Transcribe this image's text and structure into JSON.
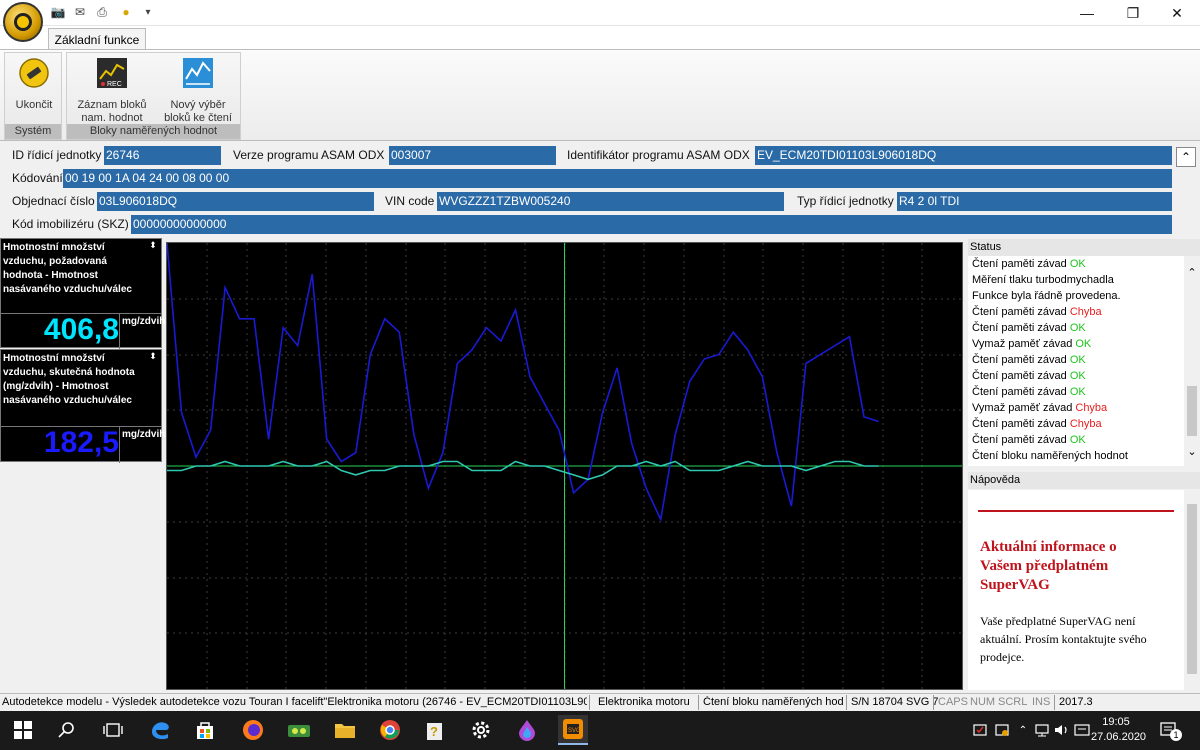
{
  "ribbon": {
    "tab_label": "Základní funkce",
    "groups": [
      {
        "label": "Systém",
        "buttons": [
          {
            "label": "Ukončit"
          }
        ]
      },
      {
        "label": "Bloky naměřených hodnot",
        "buttons": [
          {
            "label": "Záznam bloků nam. hodnot"
          },
          {
            "label": "Nový výběr bloků ke čtení"
          }
        ]
      }
    ]
  },
  "info": {
    "ecu_id_label": "ID řídicí jednotky",
    "ecu_id_value": "26746",
    "asam_ver_label": "Verze programu ASAM ODX",
    "asam_ver_value": "003007",
    "asam_id_label": "Identifikátor programu ASAM ODX",
    "asam_id_value": "EV_ECM20TDI01103L906018DQ",
    "coding_label": "Kódování",
    "coding_value": "00 19 00 1A 04 24 00 08 00 00",
    "order_label": "Objednací číslo",
    "order_value": "03L906018DQ",
    "vin_label": "VIN code",
    "vin_value": "WVGZZZ1TZBW005240",
    "ecu_type_label": "Typ řídicí jednotky",
    "ecu_type_value": "R4 2 0l TDI",
    "immo_label": "Kód imobilizéru (SKZ)",
    "immo_value": "00000000000000"
  },
  "sensors": [
    {
      "title": "Hmotnostní množství vzduchu, požadovaná hodnota - Hmotnost nasávaného vzduchu/válec",
      "value": "406,8",
      "unit": "mg/zdvih",
      "color": "#00e5ff"
    },
    {
      "title": "Hmotnostní množství vzduchu, skutečná hodnota (mg/zdvih) - Hmotnost nasávaného vzduchu/válec",
      "value": "182,5",
      "unit": "mg/zdvih",
      "color": "#1a1aff"
    }
  ],
  "status": {
    "header": "Status",
    "lines": [
      {
        "text": "Čtení paměti závad ",
        "result": "OK"
      },
      {
        "text": "Měření tlaku turbodmychadla",
        "result": ""
      },
      {
        "text": "Funkce byla řádně provedena.",
        "result": ""
      },
      {
        "text": "Čtení paměti závad ",
        "result": "Chyba"
      },
      {
        "text": "Čtení paměti závad ",
        "result": "OK"
      },
      {
        "text": "Vymaž paměť závad ",
        "result": "OK"
      },
      {
        "text": "Čtení paměti závad ",
        "result": "OK"
      },
      {
        "text": "Čtení paměti závad ",
        "result": "OK"
      },
      {
        "text": "Čtení paměti závad ",
        "result": "OK"
      },
      {
        "text": "Vymaž paměť závad ",
        "result": "Chyba"
      },
      {
        "text": "Čtení paměti závad ",
        "result": "Chyba"
      },
      {
        "text": "Čtení paměti závad ",
        "result": "OK"
      },
      {
        "text": "Čtení bloku naměřených hodnot",
        "result": ""
      }
    ]
  },
  "help": {
    "header": "Nápověda",
    "title": "Aktuální informace o Vašem předplatném SuperVAG",
    "body": "Vaše předplatné SuperVAG není aktuální. Prosím kontaktujte svého prodejce."
  },
  "statusbar": {
    "model": "Autodetekce modelu - Výsledek autodetekce vozu Touran I facelift\"Elektronika motoru (26746 - EV_ECM20TDI01103L906018DQ_",
    "module": "Elektronika motoru",
    "operation": "Čtení bloku naměřených hodno",
    "serial": "S/N 18704 SVG 7",
    "caps": "CAPS",
    "num": "NUM",
    "scrl": "SCRL",
    "ins": "INS",
    "version": "2017.3"
  },
  "taskbar": {
    "time": "19:05",
    "date": "27.06.2020",
    "notif_count": "1"
  },
  "chart_data": {
    "type": "line",
    "series": [
      {
        "values": [
          1.0,
          0.62,
          0.52,
          0.58,
          0.9,
          0.83,
          0.83,
          0.56,
          0.81,
          0.77,
          0.93,
          0.56,
          0.51,
          0.53,
          0.75,
          0.83,
          0.8,
          0.57,
          0.45,
          0.53,
          0.73,
          0.76,
          0.81,
          0.78,
          0.85,
          0.7,
          0.64,
          0.58,
          0.44,
          0.47,
          0.62,
          0.72,
          0.55,
          0.45,
          0.38,
          0.57,
          0.69,
          0.74,
          0.75,
          0.8,
          0.76,
          0.7,
          0.53,
          0.41,
          0.73,
          0.75,
          0.77,
          0.79,
          0.61,
          0.6
        ]
      },
      {
        "values": [
          0.49,
          0.49,
          0.5,
          0.5,
          0.51,
          0.5,
          0.5,
          0.5,
          0.51,
          0.5,
          0.5,
          0.51,
          0.49,
          0.48,
          0.49,
          0.49,
          0.5,
          0.5,
          0.5,
          0.51,
          0.51,
          0.49,
          0.49,
          0.49,
          0.51,
          0.5,
          0.5,
          0.49,
          0.48,
          0.47,
          0.48,
          0.5,
          0.5,
          0.51,
          0.5,
          0.51,
          0.49,
          0.49,
          0.49,
          0.5,
          0.51,
          0.5,
          0.5,
          0.5,
          0.49,
          0.5,
          0.51,
          0.51,
          0.5,
          0.5
        ]
      }
    ],
    "colors": [
      "#1a1ad4",
      "#2ec7b0"
    ],
    "grid": true,
    "cursor_color": "#23d35a"
  }
}
